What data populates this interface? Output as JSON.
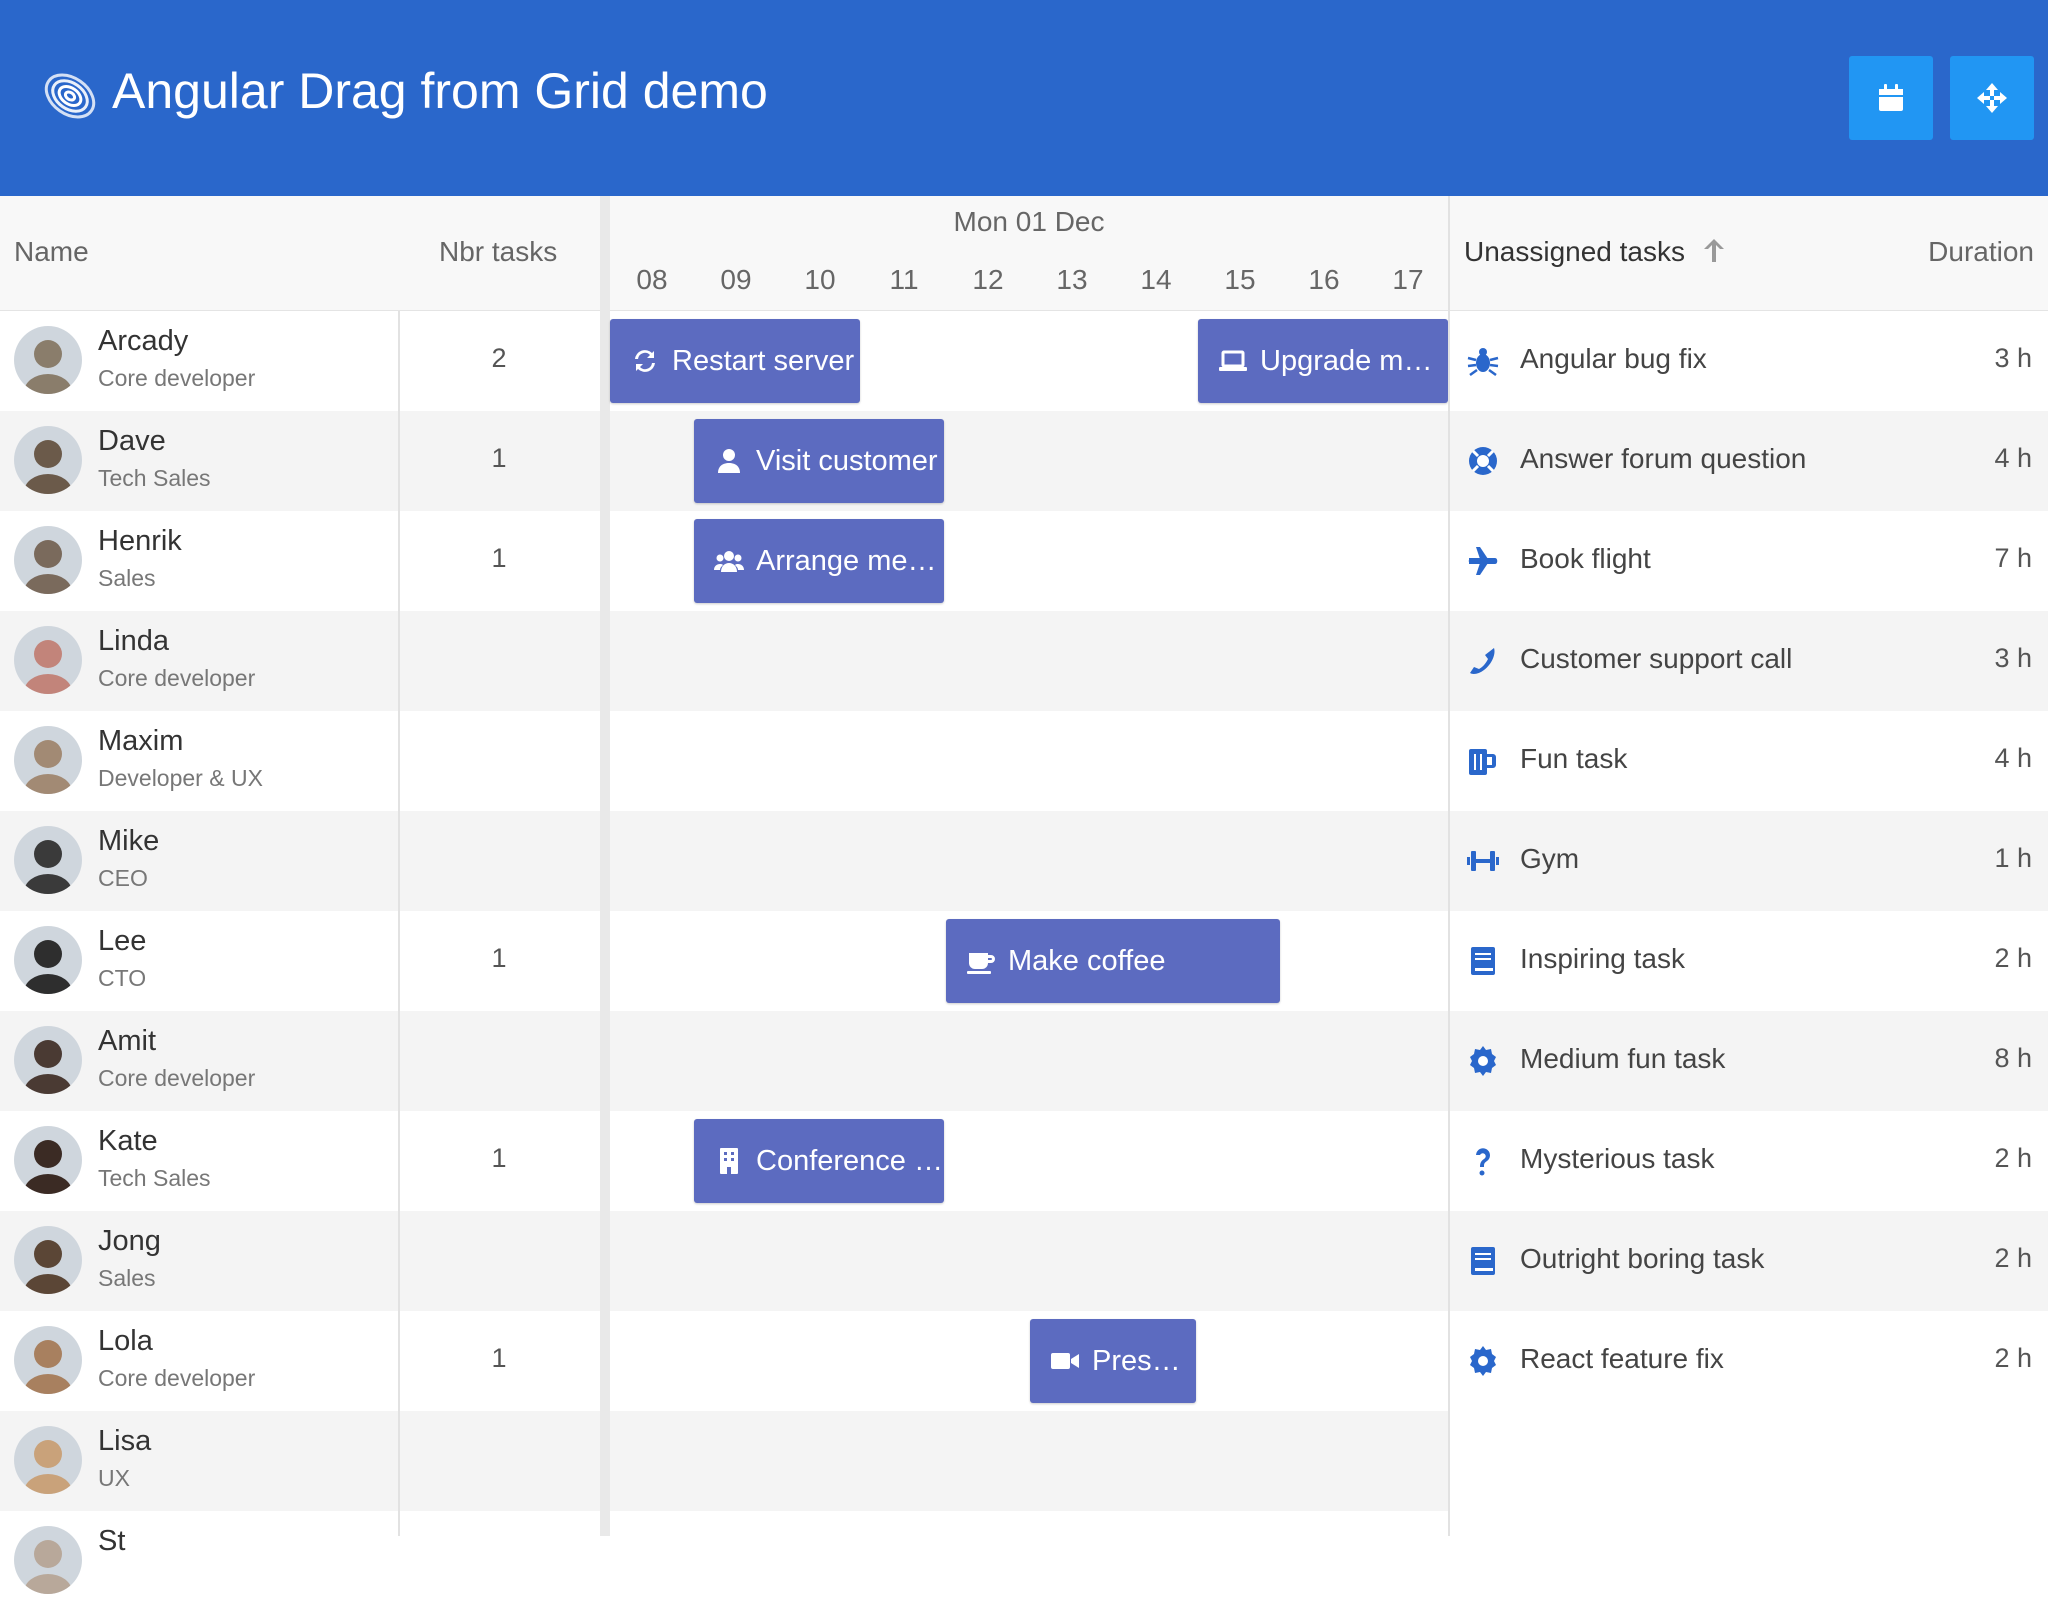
{
  "header": {
    "title": "Angular Drag from Grid demo",
    "logo_icon": "bryntum-logo-icon",
    "buttons": [
      {
        "icon": "calendar-icon"
      },
      {
        "icon": "move-arrows-icon"
      }
    ],
    "colors": {
      "bar": "#2a67cb",
      "button": "#2196f3"
    }
  },
  "grid": {
    "columns": {
      "name": "Name",
      "nbr_tasks": "Nbr tasks"
    },
    "rows": [
      {
        "name": "Arcady",
        "role": "Core developer",
        "count": "2"
      },
      {
        "name": "Dave",
        "role": "Tech Sales",
        "count": "1"
      },
      {
        "name": "Henrik",
        "role": "Sales",
        "count": "1"
      },
      {
        "name": "Linda",
        "role": "Core developer",
        "count": ""
      },
      {
        "name": "Maxim",
        "role": "Developer & UX",
        "count": ""
      },
      {
        "name": "Mike",
        "role": "CEO",
        "count": ""
      },
      {
        "name": "Lee",
        "role": "CTO",
        "count": "1"
      },
      {
        "name": "Amit",
        "role": "Core developer",
        "count": ""
      },
      {
        "name": "Kate",
        "role": "Tech Sales",
        "count": "1"
      },
      {
        "name": "Jong",
        "role": "Sales",
        "count": ""
      },
      {
        "name": "Lola",
        "role": "Core developer",
        "count": "1"
      },
      {
        "name": "Lisa",
        "role": "UX",
        "count": ""
      },
      {
        "name": "St",
        "role": "",
        "count": ""
      }
    ]
  },
  "schedule": {
    "date": "Mon 01 Dec",
    "hours": [
      "08",
      "09",
      "10",
      "11",
      "12",
      "13",
      "14",
      "15",
      "16",
      "17"
    ],
    "event_color": "#5c6bc0",
    "events": [
      {
        "row": 0,
        "start": 8,
        "end": 11,
        "label": "Restart server",
        "icon": "refresh-icon"
      },
      {
        "row": 0,
        "start": 15,
        "end": 18,
        "label": "Upgrade me…",
        "icon": "laptop-icon"
      },
      {
        "row": 1,
        "start": 9,
        "end": 12,
        "label": "Visit customer",
        "icon": "user-icon"
      },
      {
        "row": 2,
        "start": 9,
        "end": 12,
        "label": "Arrange me…",
        "icon": "users-icon"
      },
      {
        "row": 6,
        "start": 12,
        "end": 16,
        "label": "Make coffee",
        "icon": "coffee-icon"
      },
      {
        "row": 8,
        "start": 9,
        "end": 12,
        "label": "Conference …",
        "icon": "building-icon"
      },
      {
        "row": 10,
        "start": 13,
        "end": 15,
        "label": "Prese…",
        "icon": "video-icon"
      }
    ]
  },
  "unassigned": {
    "title": "Unassigned tasks",
    "duration_header": "Duration",
    "sort_icon": "arrow-up-icon",
    "icon_color": "#2a67cb",
    "tasks": [
      {
        "name": "Angular bug fix",
        "duration": "3 h",
        "icon": "bug-icon"
      },
      {
        "name": "Answer forum question",
        "duration": "4 h",
        "icon": "lifebuoy-icon"
      },
      {
        "name": "Book flight",
        "duration": "7 h",
        "icon": "plane-icon"
      },
      {
        "name": "Customer support call",
        "duration": "3 h",
        "icon": "phone-icon"
      },
      {
        "name": "Fun task",
        "duration": "4 h",
        "icon": "beer-icon"
      },
      {
        "name": "Gym",
        "duration": "1 h",
        "icon": "dumbbell-icon"
      },
      {
        "name": "Inspiring task",
        "duration": "2 h",
        "icon": "book-icon"
      },
      {
        "name": "Medium fun task",
        "duration": "8 h",
        "icon": "cog-icon"
      },
      {
        "name": "Mysterious task",
        "duration": "2 h",
        "icon": "question-icon"
      },
      {
        "name": "Outright boring task",
        "duration": "2 h",
        "icon": "book-icon"
      },
      {
        "name": "React feature fix",
        "duration": "2 h",
        "icon": "cog-icon"
      }
    ]
  }
}
